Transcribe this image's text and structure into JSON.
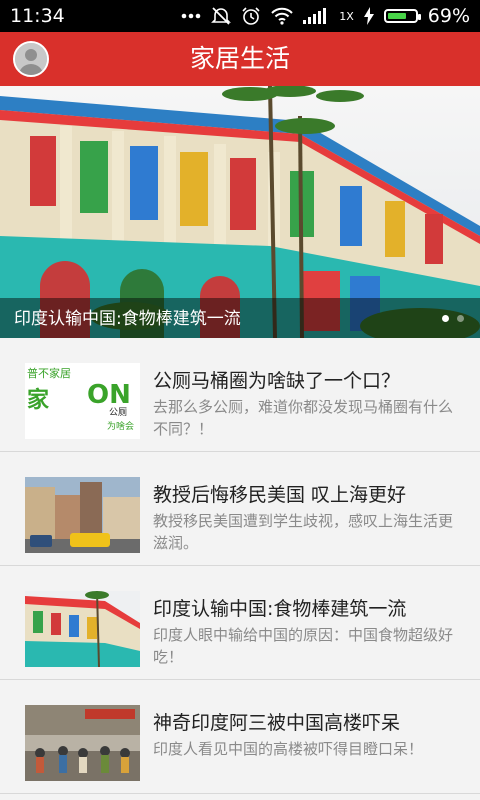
{
  "status_bar": {
    "time": "11:34",
    "network_type": "1X",
    "battery_percent": "69%",
    "battery_level": 0.69,
    "icons": [
      "more-dots-icon",
      "mute-icon",
      "alarm-icon",
      "wifi-icon",
      "signal-icon",
      "charging-icon",
      "battery-icon"
    ]
  },
  "header": {
    "title": "家居生活"
  },
  "banner": {
    "caption": "印度认输中国:食物棒建筑一流",
    "page_count": 2,
    "active_index": 0
  },
  "articles": [
    {
      "title": "公厕马桶圈为啥缺了一个口？",
      "description": "去那么多公厕，难道你都没发现马桶圈有什么不同？！",
      "thumb_text_1": "普不家居",
      "thumb_text_2": "家",
      "thumb_text_3": "ON",
      "thumb_text_4": "公厕",
      "thumb_text_5": "为啥会",
      "thumb": "logo"
    },
    {
      "title": "教授后悔移民美国 叹上海更好",
      "description": "教授移民美国遭到学生歧视，感叹上海生活更滋润。",
      "thumb": "street"
    },
    {
      "title": "印度认输中国:食物棒建筑一流",
      "description": "印度人眼中输给中国的原因：中国食物超级好吃！",
      "thumb": "building"
    },
    {
      "title": "神奇印度阿三被中国高楼吓呆",
      "description": "印度人看见中国的高楼被吓得目瞪口呆！",
      "thumb": "crowd"
    }
  ],
  "colors": {
    "header_bg": "#d9302b",
    "status_bg": "#000000",
    "list_bg": "#f3f3f3",
    "title_text": "#222222",
    "desc_text": "#8a8a8a"
  }
}
